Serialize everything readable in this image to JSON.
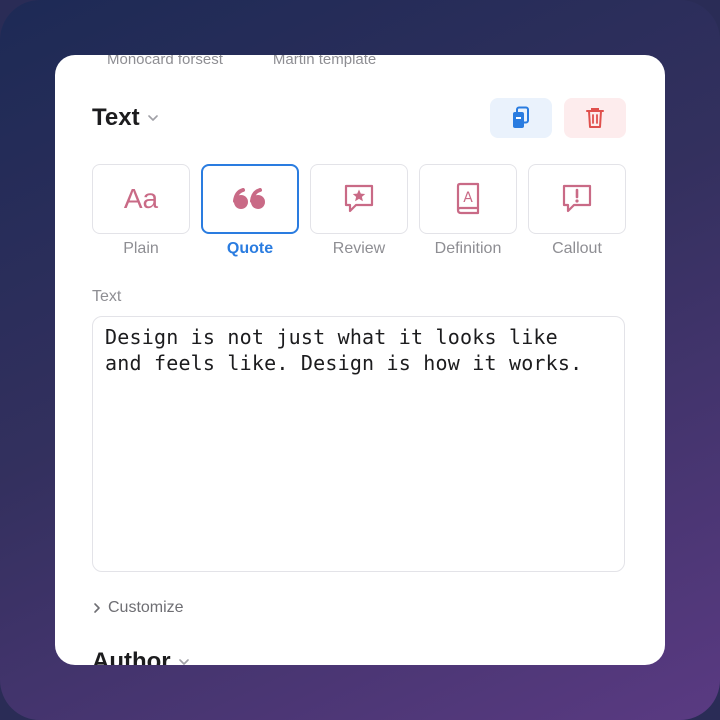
{
  "top_tabs": [
    "Monocard forsest",
    "Martin template"
  ],
  "header": {
    "title": "Text"
  },
  "actions": {
    "copy": "copy-icon",
    "delete": "trash-icon"
  },
  "styles": [
    {
      "label": "Plain",
      "glyph": "Aa",
      "icon": "aa-icon"
    },
    {
      "label": "Quote",
      "icon": "quote-icon",
      "selected": true
    },
    {
      "label": "Review",
      "icon": "star-bubble-icon"
    },
    {
      "label": "Definition",
      "icon": "book-icon"
    },
    {
      "label": "Callout",
      "icon": "exclamation-bubble-icon"
    }
  ],
  "text_field": {
    "label": "Text",
    "value": "Design is not just what it looks like\nand feels like. Design is how it works."
  },
  "customize": {
    "label": "Customize"
  },
  "author": {
    "title": "Author"
  },
  "colors": {
    "accent": "#2a7ce0",
    "icon": "#c96a86",
    "danger": "#e0504d"
  }
}
